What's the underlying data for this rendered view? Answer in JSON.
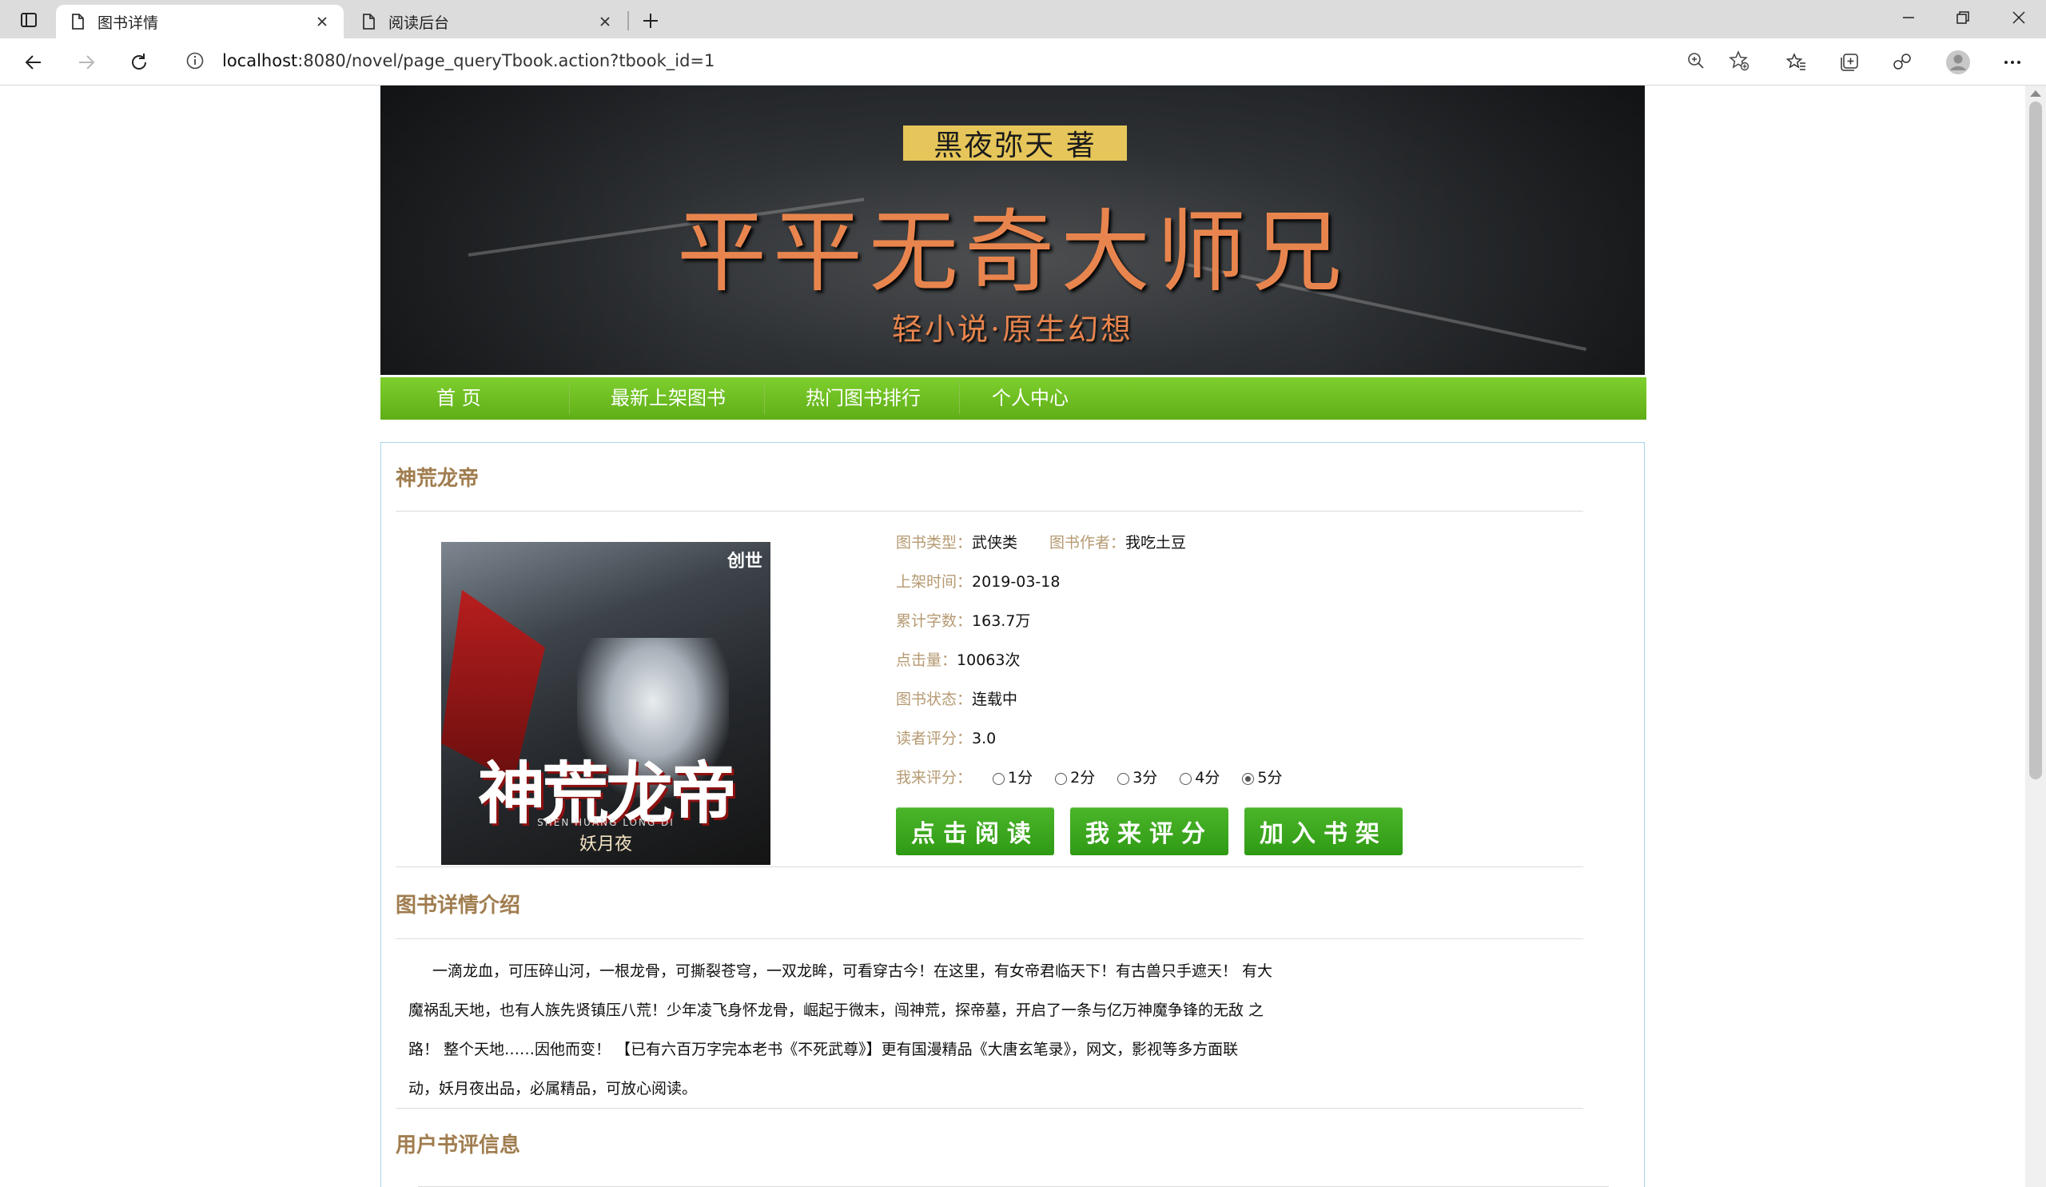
{
  "browser": {
    "tabs": [
      {
        "title": "图书详情",
        "active": true
      },
      {
        "title": "阅读后台",
        "active": false
      }
    ],
    "address": {
      "host": "localhost",
      "rest": ":8080/novel/page_queryTbook.action?tbook_id=1"
    }
  },
  "banner": {
    "author": "黑夜弥天 著",
    "title": "平平无奇大师兄",
    "subtitle": "轻小说·原生幻想"
  },
  "menu": {
    "items": [
      "首 页",
      "最新上架图书",
      "热门图书排行",
      "个人中心"
    ]
  },
  "book": {
    "name": "神荒龙帝",
    "cover": {
      "title": "神荒龙帝",
      "pinyin": "SHEN HUANG LONG DI",
      "author": "妖月夜",
      "logo": "创世"
    },
    "type_label": "图书类型：",
    "type": "武侠类",
    "author_label": "图书作者：",
    "author": "我吃土豆",
    "date_label": "上架时间：",
    "date": "2019-03-18",
    "words_label": "累计字数：",
    "words": "163.7万",
    "clicks_label": "点击量：",
    "clicks": "10063次",
    "status_label": "图书状态：",
    "status": "连载中",
    "rating_label": "读者评分：",
    "rating": "3.0",
    "my_rating_label": "我来评分：",
    "rating_options": [
      "1分",
      "2分",
      "3分",
      "4分",
      "5分"
    ],
    "rating_selected": "5分",
    "buttons": {
      "read": "点击阅读",
      "rate": "我来评分",
      "shelf": "加入书架"
    }
  },
  "detail": {
    "title": "图书详情介绍",
    "lines": [
      "一滴龙血，可压碎山河，一根龙骨，可撕裂苍穹，一双龙眸，可看穿古今！在这里，有女帝君临天下！有古兽只手遮天！ 有大",
      "魔祸乱天地，也有人族先贤镇压八荒！少年凌飞身怀龙骨，崛起于微末，闯神荒，探帝墓，开启了一条与亿万神魔争锋的无敌 之",
      "路！ 整个天地……因他而变！ 【已有六百万字完本老书《不死武尊》】更有国漫精品《大唐玄笔录》，网文，影视等多方面联",
      "动，妖月夜出品，必属精品，可放心阅读。"
    ]
  },
  "comments": {
    "title": "用户书评信息"
  }
}
